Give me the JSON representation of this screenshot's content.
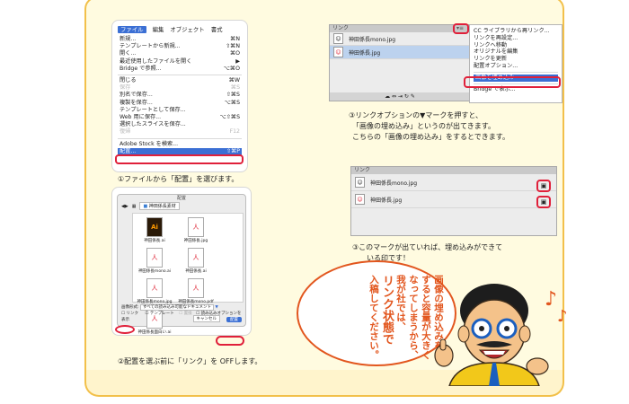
{
  "menu": {
    "bar": [
      "ファイル",
      "編集",
      "オブジェクト",
      "書式"
    ],
    "items": [
      {
        "label": "新規...",
        "shortcut": "⌘N",
        "state": "normal"
      },
      {
        "label": "テンプレートから新規...",
        "shortcut": "⇧⌘N",
        "state": "normal"
      },
      {
        "label": "開く...",
        "shortcut": "⌘O",
        "state": "normal"
      },
      {
        "label": "最近使用したファイルを開く",
        "shortcut": "▶",
        "state": "normal"
      },
      {
        "label": "Bridge で参照...",
        "shortcut": "⌥⌘O",
        "state": "normal"
      },
      {
        "label": "---"
      },
      {
        "label": "閉じる",
        "shortcut": "⌘W",
        "state": "normal"
      },
      {
        "label": "保存",
        "shortcut": "⌘S",
        "state": "dim"
      },
      {
        "label": "別名で保存...",
        "shortcut": "⇧⌘S",
        "state": "normal"
      },
      {
        "label": "複製を保存...",
        "shortcut": "⌥⌘S",
        "state": "normal"
      },
      {
        "label": "テンプレートとして保存...",
        "shortcut": "",
        "state": "normal"
      },
      {
        "label": "Web 用に保存...",
        "shortcut": "⌥⇧⌘S",
        "state": "normal"
      },
      {
        "label": "選択したスライスを保存...",
        "shortcut": "",
        "state": "normal"
      },
      {
        "label": "復帰",
        "shortcut": "F12",
        "state": "dim"
      },
      {
        "label": "---"
      },
      {
        "label": "Adobe Stock を検索...",
        "shortcut": "",
        "state": "normal"
      },
      {
        "label": "配置...",
        "shortcut": "⇧⌘P",
        "state": "highlight"
      }
    ]
  },
  "captions": {
    "c1": "①ファイルから「配置」を選びます。",
    "c2": "②配置を選ぶ前に「リンク」を OFFします。",
    "c3a": "③リンクオプションの▼マークを押すと、",
    "c3b": "「画像の埋め込み」というのが出てきます。",
    "c3c": "こちらの「画像の埋め込み」をするとできます。",
    "c4a": "③このマークが出ていれば、埋め込みができて",
    "c4b": "いる印です！"
  },
  "links_panel_top": {
    "title": "リンク",
    "files": [
      "神田係長mono.jpg",
      "神田係長.jpg"
    ]
  },
  "flyout": {
    "items": [
      "CC ライブラリから再リンク...",
      "リンクを再設定...",
      "リンクへ移動",
      "オリジナルを編集",
      "リンクを更新",
      "配置オプション..."
    ],
    "embed": "画像を埋め込み",
    "bridge": "Bridge で表示..."
  },
  "links_panel_bottom": {
    "title": "リンク",
    "files": [
      "神田係長mono.jpg",
      "神田係長.jpg"
    ]
  },
  "place_dialog": {
    "title": "配置",
    "folder": "神田係長素材",
    "files": [
      {
        "name": "神田係長.ai",
        "icon": "Ai"
      },
      {
        "name": "神田係長.jpg",
        "icon": "人"
      },
      {
        "name": "神田係長mono.ai",
        "icon": "人"
      },
      {
        "name": "神田係長.ai",
        "icon": "人"
      },
      {
        "name": "神田係長mono.jpg",
        "icon": "人"
      },
      {
        "name": "神田係長mono.pdf",
        "icon": "人"
      },
      {
        "name": "神田係長面白い.ai",
        "icon": "人"
      }
    ],
    "format_label": "画像形式",
    "format_value": "すべての読み込み可能なドキュメント",
    "link_label": "リンク",
    "template_label": "テンプレート",
    "replace_label": "置換",
    "options_label": "読み込みオプションを表示",
    "cancel": "キャンセル",
    "place": "配置"
  },
  "bubble": {
    "lines": [
      "画像の埋め込みを",
      "すると容量が大きく",
      "なってしまうから、",
      "我が社では、",
      "リンク状態で",
      "入稿してください。"
    ]
  },
  "colors": {
    "frame_border": "#f2c04a",
    "accent_red": "#e0203a",
    "bubble_orange": "#e2561e",
    "menu_highlight": "#3b6fd4"
  }
}
